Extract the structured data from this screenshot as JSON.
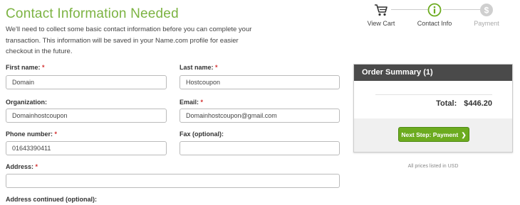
{
  "page": {
    "title": "Contact Information Needed",
    "intro": "We'll need to collect some basic contact information before you can complete your transaction. This information will be saved in your Name.com profile for easier checkout in the future."
  },
  "form": {
    "first_name": {
      "label": "First name:",
      "value": "Domain"
    },
    "last_name": {
      "label": "Last name:",
      "value": "Hostcoupon"
    },
    "organization": {
      "label": "Organization:",
      "value": "Domainhostcoupon"
    },
    "email": {
      "label": "Email:",
      "value": "Domainhostcoupon@gmail.com"
    },
    "phone": {
      "label": "Phone number:",
      "value": "01643390411"
    },
    "fax": {
      "label": "Fax (optional):",
      "value": ""
    },
    "address": {
      "label": "Address:",
      "value": ""
    },
    "address2": {
      "label": "Address continued (optional):"
    },
    "required_marker": "*"
  },
  "steps": [
    {
      "label": "View Cart",
      "icon": "cart-icon",
      "state": "done"
    },
    {
      "label": "Contact Info",
      "icon": "info-icon",
      "state": "current"
    },
    {
      "label": "Payment",
      "icon": "dollar-icon",
      "state": "disabled"
    }
  ],
  "summary": {
    "title": "Order Summary",
    "count": "(1)",
    "total_label": "Total:",
    "total_value": "$446.20",
    "next_button": "Next Step: Payment",
    "note": "All prices listed in USD"
  },
  "colors": {
    "accent_green": "#7cb342",
    "button_green": "#6cab1f",
    "header_dark": "#4a4a4a",
    "required_red": "#d32f2f"
  }
}
